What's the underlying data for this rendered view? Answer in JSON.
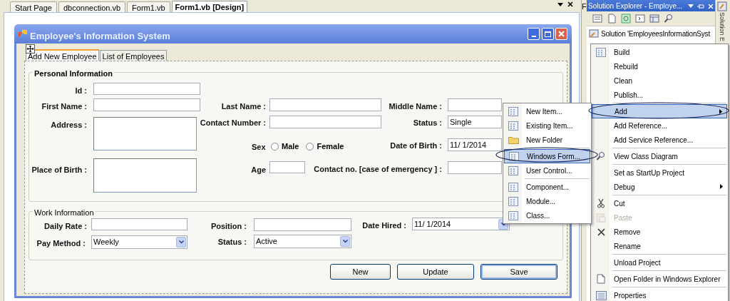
{
  "editor_tabs": [
    {
      "label": "Start Page",
      "selected": false
    },
    {
      "label": "dbconnection.vb",
      "selected": false
    },
    {
      "label": "Form1.vb",
      "selected": false
    },
    {
      "label": "Form1.vb [Design]",
      "selected": true
    }
  ],
  "form": {
    "title": "Employee's Information System",
    "tabs": [
      {
        "label": "Add New Employee",
        "selected": true
      },
      {
        "label": "List of Employees",
        "selected": false
      }
    ],
    "personal_information": {
      "title": "Personal Information",
      "fields": [
        {
          "kind": "text",
          "label": "Id :"
        },
        {
          "kind": "text",
          "label": "First Name :"
        },
        {
          "kind": "text",
          "label": "Last Name :"
        },
        {
          "kind": "text",
          "label": "Middle Name :"
        },
        {
          "kind": "textarea",
          "label": "Address :"
        },
        {
          "kind": "text",
          "label": "Contact Number :"
        },
        {
          "kind": "combo",
          "label": "Status :",
          "value": "Single"
        },
        {
          "kind": "radio",
          "label": "Sex",
          "options": [
            {
              "label": "Male",
              "selected": false
            },
            {
              "label": "Female",
              "selected": false
            }
          ]
        },
        {
          "kind": "date",
          "label": "Date of Birth :",
          "value": "11/ 1/2014"
        },
        {
          "kind": "textarea",
          "label": "Place of Birth :"
        },
        {
          "kind": "text",
          "label": "Age"
        },
        {
          "kind": "text",
          "label": "Contact no. [case of emergency ] :"
        }
      ]
    },
    "work_information": {
      "title": "Work Information",
      "fields": [
        {
          "kind": "text",
          "label": "Daily Rate :"
        },
        {
          "kind": "text",
          "label": "Position :"
        },
        {
          "kind": "date",
          "label": "Date Hired :",
          "value": "11/ 1/2014"
        },
        {
          "kind": "combo",
          "label": "Pay Method :",
          "value": "Weekly"
        },
        {
          "kind": "combo",
          "label": "Status :",
          "value": "Active"
        }
      ]
    },
    "buttons": [
      "New",
      "Update",
      "Save"
    ]
  },
  "side_strip": "F",
  "solution_explorer": {
    "title": "Solution Explorer - Employe...",
    "side_tab": "Solution E",
    "tree": [
      {
        "label": "Solution 'EmployeesInformationSyst"
      }
    ]
  },
  "context_menu": [
    {
      "label": "Build",
      "separator_before": false,
      "highlighted": false,
      "disabled": false,
      "submenu": false
    },
    {
      "label": "Rebuild",
      "separator_before": false,
      "highlighted": false,
      "disabled": false,
      "submenu": false
    },
    {
      "label": "Clean",
      "separator_before": false,
      "highlighted": false,
      "disabled": false,
      "submenu": false
    },
    {
      "label": "Publish...",
      "separator_before": false,
      "highlighted": false,
      "disabled": false,
      "submenu": false
    },
    {
      "label": "Add",
      "separator_before": true,
      "highlighted": true,
      "disabled": false,
      "submenu": true
    },
    {
      "label": "Add Reference...",
      "separator_before": false,
      "highlighted": false,
      "disabled": false,
      "submenu": false
    },
    {
      "label": "Add Service Reference...",
      "separator_before": false,
      "highlighted": false,
      "disabled": false,
      "submenu": false
    },
    {
      "label": "View Class Diagram",
      "separator_before": true,
      "highlighted": false,
      "disabled": false,
      "submenu": false
    },
    {
      "label": "Set as StartUp Project",
      "separator_before": true,
      "highlighted": false,
      "disabled": false,
      "submenu": false
    },
    {
      "label": "Debug",
      "separator_before": false,
      "highlighted": false,
      "disabled": false,
      "submenu": true
    },
    {
      "label": "Cut",
      "separator_before": true,
      "highlighted": false,
      "disabled": false,
      "submenu": false
    },
    {
      "label": "Paste",
      "separator_before": false,
      "highlighted": false,
      "disabled": true,
      "submenu": false
    },
    {
      "label": "Remove",
      "separator_before": false,
      "highlighted": false,
      "disabled": false,
      "submenu": false
    },
    {
      "label": "Rename",
      "separator_before": false,
      "highlighted": false,
      "disabled": false,
      "submenu": false
    },
    {
      "label": "Unload Project",
      "separator_before": true,
      "highlighted": false,
      "disabled": false,
      "submenu": false
    },
    {
      "label": "Open Folder in Windows Explorer",
      "separator_before": true,
      "highlighted": false,
      "disabled": false,
      "submenu": false
    },
    {
      "label": "Properties",
      "separator_before": true,
      "highlighted": false,
      "disabled": false,
      "submenu": false
    }
  ],
  "add_submenu": [
    {
      "label": "New Item...",
      "separator_before": false,
      "highlighted": false
    },
    {
      "label": "Existing Item...",
      "separator_before": false,
      "highlighted": false
    },
    {
      "label": "New Folder",
      "separator_before": false,
      "highlighted": false
    },
    {
      "label": "Windows Form...",
      "separator_before": true,
      "highlighted": true
    },
    {
      "label": "User Control...",
      "separator_before": false,
      "highlighted": false
    },
    {
      "label": "Component...",
      "separator_before": true,
      "highlighted": false
    },
    {
      "label": "Module...",
      "separator_before": false,
      "highlighted": false
    },
    {
      "label": "Class...",
      "separator_before": false,
      "highlighted": false
    }
  ]
}
